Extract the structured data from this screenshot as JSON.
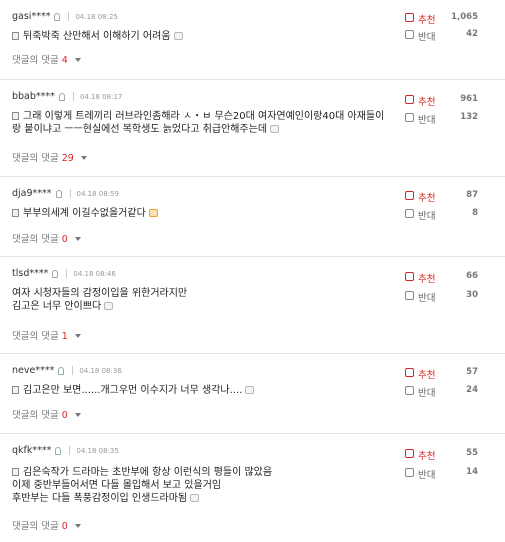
{
  "comments": [
    {
      "user": "gasi****",
      "date": "04.18 08:25",
      "lines": [
        "뒤죽박죽 산만해서 이해하기 어려움"
      ],
      "reply_label": "댓글의 댓글",
      "reply_count": "4",
      "recommend_label": "추천",
      "recommend_count": "1,065",
      "oppose_label": "반대",
      "oppose_count": "42"
    },
    {
      "user": "bbab****",
      "date": "04.18 08:17",
      "lines": [
        "그래 이렇게 트레끼리 러브라인좀해라 ㅅ・ㅂ 무슨20대 여자연예인이랑40대 아재들이",
        "랑 붙이냐고 ㅡㅡ현실에선 복학생도 늙었다고 취급안해주는데"
      ],
      "reply_label": "댓글의 댓글",
      "reply_count": "29",
      "recommend_label": "추천",
      "recommend_count": "961",
      "oppose_label": "반대",
      "oppose_count": "132"
    },
    {
      "user": "dja9****",
      "date": "04.18 08:59",
      "lines": [
        "부부의세계 이길수없을거같다"
      ],
      "reply_label": "댓글의 댓글",
      "reply_count": "0",
      "recommend_label": "추천",
      "recommend_count": "87",
      "oppose_label": "반대",
      "oppose_count": "8"
    },
    {
      "user": "tlsd****",
      "date": "04.18 08:46",
      "lines": [
        "여자 시청자들의 감정이입을 위한거라지만",
        "김고은 너무 안이쁘다"
      ],
      "reply_label": "댓글의 댓글",
      "reply_count": "1",
      "recommend_label": "추천",
      "recommend_count": "66",
      "oppose_label": "반대",
      "oppose_count": "30"
    },
    {
      "user": "neve****",
      "date": "04.18 08:36",
      "lines": [
        "김고은만 보면......개그우먼 이수지가 너무 생각나...."
      ],
      "reply_label": "댓글의 댓글",
      "reply_count": "0",
      "recommend_label": "추천",
      "recommend_count": "57",
      "oppose_label": "반대",
      "oppose_count": "24"
    },
    {
      "user": "qkfk****",
      "date": "04.18 08:35",
      "lines": [
        "김은숙작가 드라마는 초반부에 항상 이런식의 평들이 많았음",
        "이제 중반부들어서면 다들 몰입해서 보고 있을거임",
        "후반부는 다들 폭풍감정이입 인생드라마됨"
      ],
      "reply_label": "댓글의 댓글",
      "reply_count": "0",
      "recommend_label": "추천",
      "recommend_count": "55",
      "oppose_label": "반대",
      "oppose_count": "14"
    }
  ]
}
